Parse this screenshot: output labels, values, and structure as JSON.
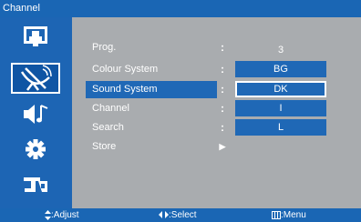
{
  "window": {
    "title": "Channel"
  },
  "sidebar": {
    "icons": [
      {
        "name": "picture-icon"
      },
      {
        "name": "channel-antenna-icon",
        "selected": true
      },
      {
        "name": "sound-icon"
      },
      {
        "name": "setup-gear-icon"
      },
      {
        "name": "input-icon"
      }
    ]
  },
  "menu": {
    "items": [
      {
        "label": "Prog.",
        "value": "3"
      },
      {
        "label": "Colour System"
      },
      {
        "label": "Sound System",
        "selected": true
      },
      {
        "label": "Channel"
      },
      {
        "label": "Search"
      },
      {
        "label": "Store",
        "arrow": "▶"
      }
    ],
    "colon": ":"
  },
  "sound_system_options": [
    "BG",
    "DK",
    "I",
    "L"
  ],
  "footer": {
    "adjust_label": ":Adjust",
    "select_label": ":Select",
    "menu_label": ":Menu"
  },
  "colors": {
    "accent_blue": "#1a66b4",
    "panel_gray": "#a9acaf",
    "text": "#ffffff"
  }
}
